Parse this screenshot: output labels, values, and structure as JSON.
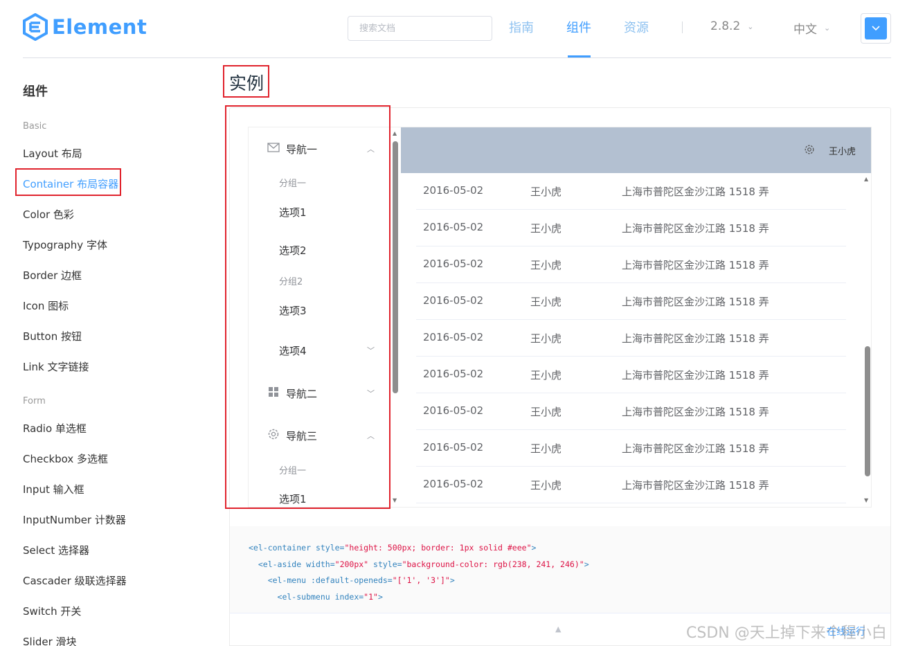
{
  "header": {
    "logo_text": "Element",
    "search_placeholder": "搜索文档",
    "nav": [
      "指南",
      "组件",
      "资源"
    ],
    "version": "2.8.2",
    "language": "中文"
  },
  "sidebar": {
    "title": "组件",
    "groups": {
      "basic": "Basic",
      "form": "Form"
    },
    "basic_items": [
      "Layout 布局",
      "Container 布局容器",
      "Color 色彩",
      "Typography 字体",
      "Border 边框",
      "Icon 图标",
      "Button 按钮",
      "Link 文字链接"
    ],
    "form_items": [
      "Radio 单选框",
      "Checkbox 多选框",
      "Input 输入框",
      "InputNumber 计数器",
      "Select 选择器",
      "Cascader 级联选择器",
      "Switch 开关",
      "Slider 滑块"
    ]
  },
  "main": {
    "section_title": "实例",
    "demo": {
      "menu": {
        "nav1": "导航一",
        "group1": "分组一",
        "opt1": "选项1",
        "opt2": "选项2",
        "group2": "分组2",
        "opt3": "选项3",
        "opt4": "选项4",
        "nav2": "导航二",
        "nav3": "导航三",
        "group3": "分组一",
        "opt5": "选项1"
      },
      "header_user": "王小虎",
      "rows": [
        {
          "date": "2016-05-02",
          "name": "王小虎",
          "address": "上海市普陀区金沙江路 1518 弄"
        },
        {
          "date": "2016-05-02",
          "name": "王小虎",
          "address": "上海市普陀区金沙江路 1518 弄"
        },
        {
          "date": "2016-05-02",
          "name": "王小虎",
          "address": "上海市普陀区金沙江路 1518 弄"
        },
        {
          "date": "2016-05-02",
          "name": "王小虎",
          "address": "上海市普陀区金沙江路 1518 弄"
        },
        {
          "date": "2016-05-02",
          "name": "王小虎",
          "address": "上海市普陀区金沙江路 1518 弄"
        },
        {
          "date": "2016-05-02",
          "name": "王小虎",
          "address": "上海市普陀区金沙江路 1518 弄"
        },
        {
          "date": "2016-05-02",
          "name": "王小虎",
          "address": "上海市普陀区金沙江路 1518 弄"
        },
        {
          "date": "2016-05-02",
          "name": "王小虎",
          "address": "上海市普陀区金沙江路 1518 弄"
        },
        {
          "date": "2016-05-02",
          "name": "王小虎",
          "address": "上海市普陀区金沙江路 1518 弄"
        }
      ]
    },
    "code": {
      "l1_tag": "<el-container",
      "l1_attr": " style=",
      "l1_val": "\"height: 500px; border: 1px solid #eee\"",
      "l1_end": ">",
      "l2_tag": "  <el-aside",
      "l2_attr": " width=",
      "l2_val": "\"200px\"",
      "l2_attr2": " style=",
      "l2_val2": "\"background-color: rgb(238, 241, 246)\"",
      "l2_end": ">",
      "l3_tag": "    <el-menu",
      "l3_attr": " :default-openeds=",
      "l3_val": "\"['1', '3']\"",
      "l3_end": ">",
      "l4_tag": "      <el-submenu",
      "l4_attr": " index=",
      "l4_val": "\"1\"",
      "l4_end": ">"
    },
    "control_text": "在线运行"
  },
  "watermark": "CSDN @天上掉下来个程小白",
  "colors": {
    "accent": "#409eff",
    "highlight": "#e0222c",
    "header_bg": "#b3c0d1"
  }
}
